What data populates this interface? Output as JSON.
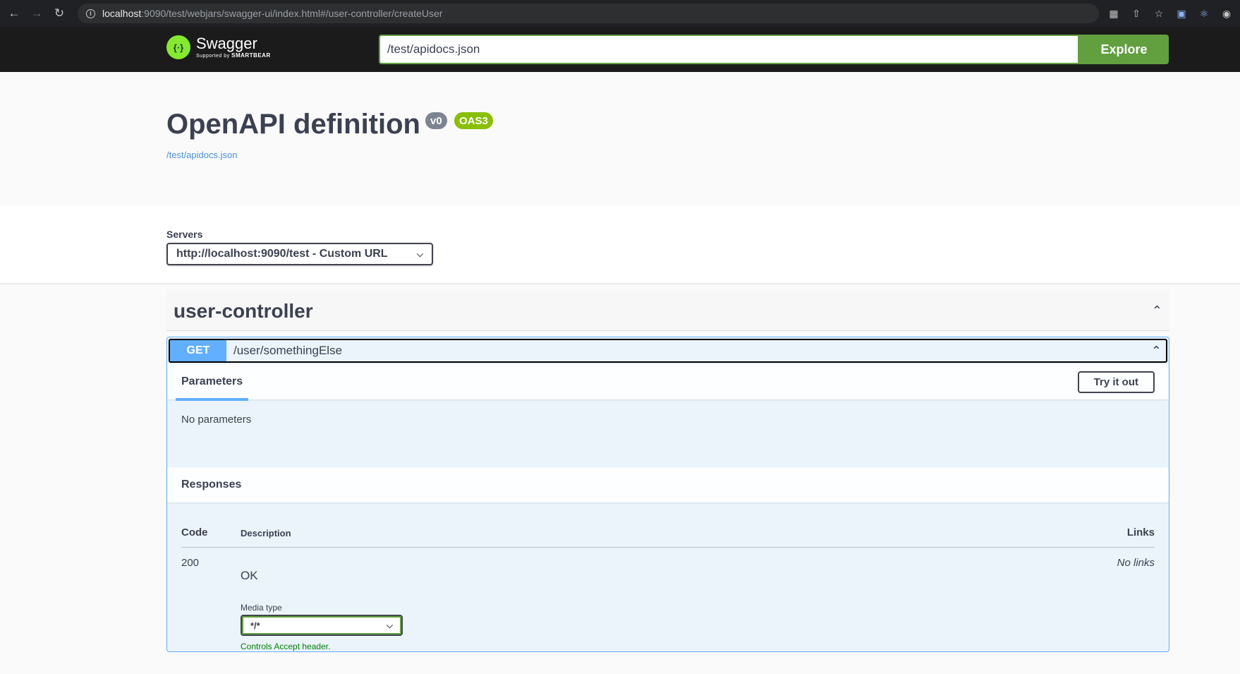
{
  "browser": {
    "url_host": "localhost",
    "url_rest": ":9090/test/webjars/swagger-ui/index.html#/user-controller/createUser"
  },
  "topbar": {
    "logo_name": "Swagger",
    "logo_supported": "Supported by",
    "logo_company": "SMARTBEAR",
    "spec_url": "/test/apidocs.json",
    "explore_label": "Explore"
  },
  "info": {
    "title": "OpenAPI definition",
    "version": "v0",
    "oas": "OAS3",
    "spec_link": "/test/apidocs.json"
  },
  "servers": {
    "label": "Servers",
    "selected": "http://localhost:9090/test - Custom URL"
  },
  "controller": {
    "name": "user-controller",
    "operation": {
      "method": "GET",
      "path": "/user/somethingElse",
      "parameters_tab": "Parameters",
      "try_it_out": "Try it out",
      "no_parameters": "No parameters",
      "responses_title": "Responses",
      "col_code": "Code",
      "col_description": "Description",
      "col_links": "Links",
      "response": {
        "code": "200",
        "description": "OK",
        "media_type_label": "Media type",
        "media_type": "*/*",
        "controls_text": "Controls Accept header.",
        "links": "No links"
      }
    }
  },
  "colors": {
    "get_method": "#61affe",
    "swagger_green": "#62a03f",
    "oas_badge": "#89bf04"
  }
}
